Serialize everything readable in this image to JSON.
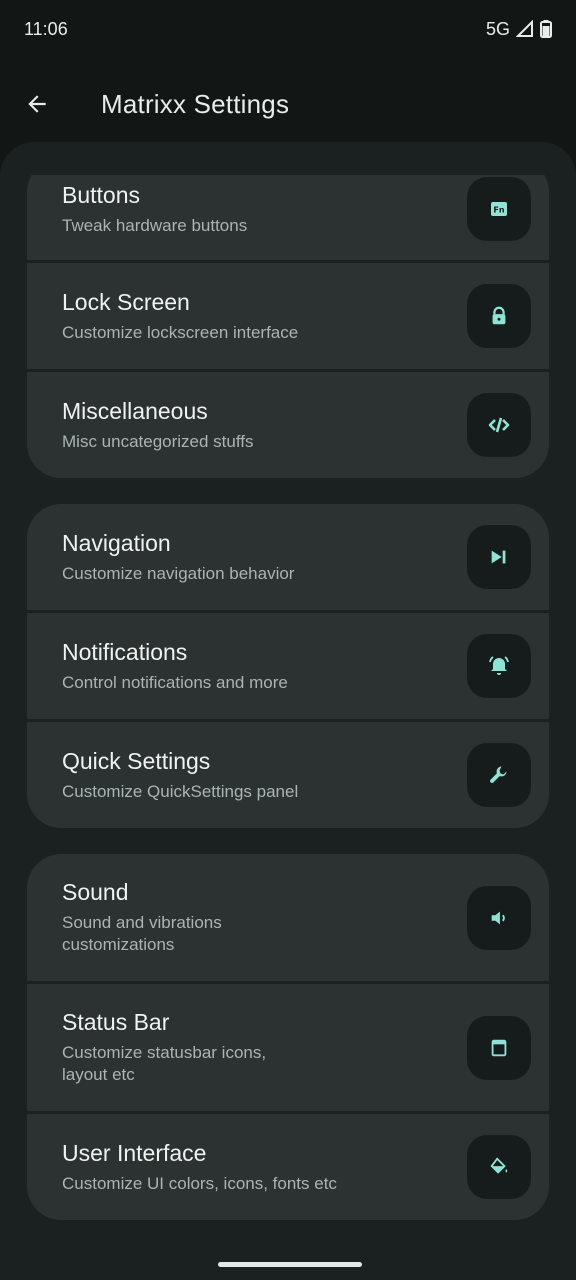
{
  "status_bar": {
    "time": "11:06",
    "network": "5G"
  },
  "app_bar": {
    "title": "Matrixx Settings"
  },
  "groups": [
    {
      "items": [
        {
          "title": "Buttons",
          "subtitle": "Tweak hardware buttons",
          "icon": "fn-key-icon"
        },
        {
          "title": "Lock Screen",
          "subtitle": "Customize lockscreen interface",
          "icon": "lock-icon"
        },
        {
          "title": "Miscellaneous",
          "subtitle": "Misc uncategorized stuffs",
          "icon": "code-icon"
        }
      ]
    },
    {
      "items": [
        {
          "title": "Navigation",
          "subtitle": "Customize navigation behavior",
          "icon": "navigation-icon"
        },
        {
          "title": "Notifications",
          "subtitle": "Control notifications and more",
          "icon": "notification-bell-icon"
        },
        {
          "title": "Quick Settings",
          "subtitle": "Customize QuickSettings panel",
          "icon": "wrench-icon"
        }
      ]
    },
    {
      "items": [
        {
          "title": "Sound",
          "subtitle": "Sound and vibrations customizations",
          "icon": "volume-icon"
        },
        {
          "title": "Status Bar",
          "subtitle": "Customize statusbar icons, layout etc",
          "icon": "statusbar-icon"
        },
        {
          "title": "User Interface",
          "subtitle": "Customize UI colors, icons, fonts etc",
          "icon": "paint-bucket-icon"
        }
      ]
    }
  ],
  "colors": {
    "background": "#121716",
    "card": "#2c3231",
    "accent": "#8fe3d4"
  }
}
